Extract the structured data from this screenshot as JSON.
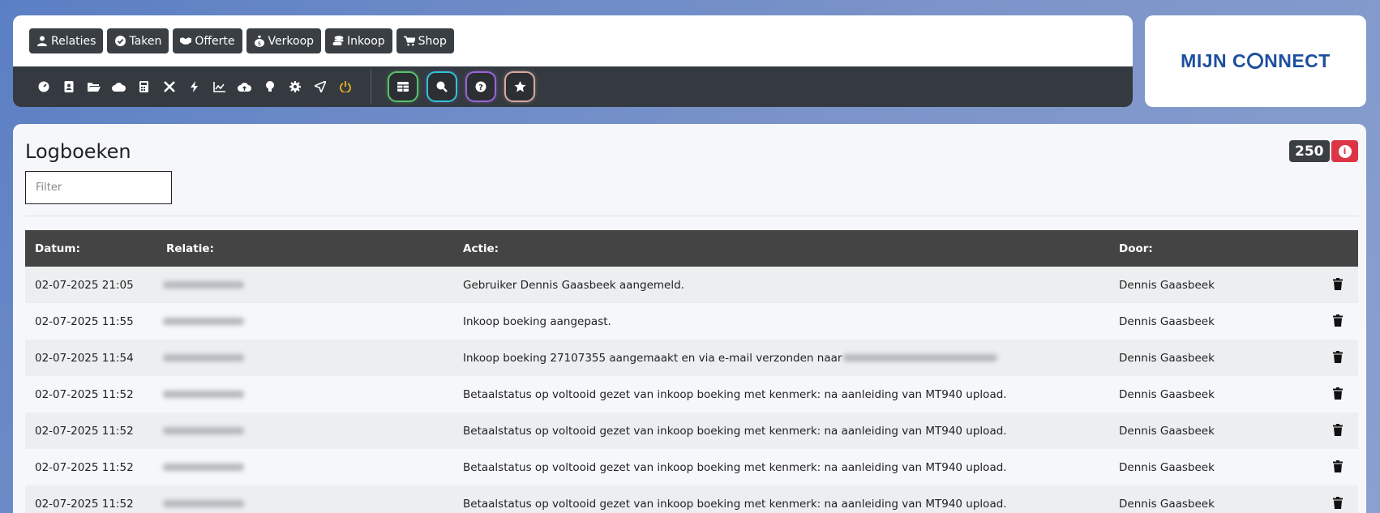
{
  "nav": {
    "buttons": [
      {
        "label": "Relaties",
        "icon": "user-icon"
      },
      {
        "label": "Taken",
        "icon": "check-circle-icon"
      },
      {
        "label": "Offerte",
        "icon": "handshake-icon"
      },
      {
        "label": "Verkoop",
        "icon": "money-bag-icon"
      },
      {
        "label": "Inkoop",
        "icon": "coins-icon"
      },
      {
        "label": "Shop",
        "icon": "cart-icon"
      }
    ],
    "tools": [
      "dashboard-icon",
      "address-book-icon",
      "folder-icon",
      "cloud-icon",
      "calculator-icon",
      "tools-icon",
      "bolt-icon",
      "chart-line-icon",
      "cloud-upload-icon",
      "lightbulb-icon",
      "gear-icon",
      "send-icon",
      "power-icon"
    ],
    "quick": [
      "table-icon",
      "search-magnify-icon",
      "question-icon",
      "star-icon"
    ]
  },
  "logo": {
    "part1": "MIJN C",
    "part2": "NNECT"
  },
  "page": {
    "title": "Logboeken",
    "filter_placeholder": "Filter",
    "count": "250"
  },
  "table": {
    "headers": [
      "Datum:",
      "Relatie:",
      "Actie:",
      "Door:"
    ],
    "rows": [
      {
        "datum": "02-07-2025 21:05",
        "actie": "Gebruiker Dennis Gaasbeek aangemeld.",
        "door": "Dennis Gaasbeek"
      },
      {
        "datum": "02-07-2025 11:55",
        "actie": "Inkoop boeking aangepast.",
        "door": "Dennis Gaasbeek"
      },
      {
        "datum": "02-07-2025 11:54",
        "actie": "Inkoop boeking 27107355 aangemaakt en via e-mail verzonden naar",
        "door": "Dennis Gaasbeek"
      },
      {
        "datum": "02-07-2025 11:52",
        "actie": "Betaalstatus op voltooid gezet van inkoop boeking met kenmerk: na aanleiding van MT940 upload.",
        "door": "Dennis Gaasbeek"
      },
      {
        "datum": "02-07-2025 11:52",
        "actie": "Betaalstatus op voltooid gezet van inkoop boeking met kenmerk: na aanleiding van MT940 upload.",
        "door": "Dennis Gaasbeek"
      },
      {
        "datum": "02-07-2025 11:52",
        "actie": "Betaalstatus op voltooid gezet van inkoop boeking met kenmerk: na aanleiding van MT940 upload.",
        "door": "Dennis Gaasbeek"
      },
      {
        "datum": "02-07-2025 11:52",
        "actie": "Betaalstatus op voltooid gezet van inkoop boeking met kenmerk: na aanleiding van MT940 upload.",
        "door": "Dennis Gaasbeek"
      }
    ]
  }
}
